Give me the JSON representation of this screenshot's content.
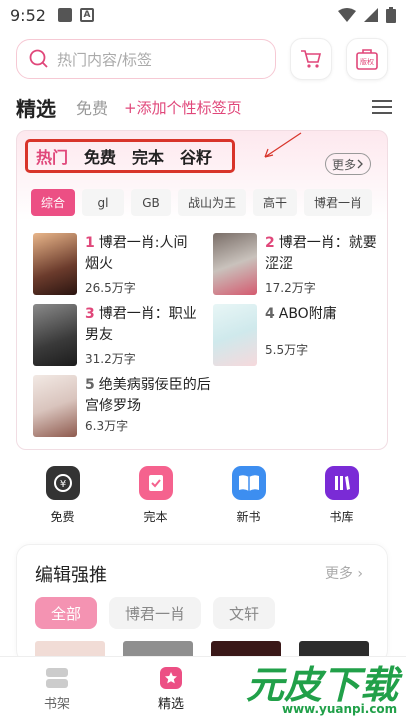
{
  "status": {
    "time": "9:52"
  },
  "search": {
    "placeholder": "热门内容/标签"
  },
  "header": {
    "badge_label": "版权"
  },
  "tabs": {
    "selected": "精选",
    "free": "免费",
    "add": "+添加个性标签页"
  },
  "hot": {
    "categories": [
      "热门",
      "免费",
      "完本",
      "谷籽"
    ],
    "more": "更多",
    "tags": [
      "综合",
      "gl",
      "GB",
      "战山为王",
      "高干",
      "博君一肖"
    ],
    "books": [
      {
        "rank": "1",
        "title": "博君一肖:人间烟火",
        "count": "26.5万字"
      },
      {
        "rank": "2",
        "title": "博君一肖：就要涩涩",
        "count": "17.2万字"
      },
      {
        "rank": "3",
        "title": "博君一肖：职业男友",
        "count": "31.2万字"
      },
      {
        "rank": "4",
        "title": "ABO附庸",
        "count": "5.5万字"
      },
      {
        "rank": "5",
        "title": "绝美病弱佞臣的后宫修罗场",
        "count": "6.3万字"
      }
    ]
  },
  "quick": [
    {
      "label": "免费",
      "icon": "coin-icon",
      "color": "#333333"
    },
    {
      "label": "完本",
      "icon": "check-book-icon",
      "color": "#f5628e"
    },
    {
      "label": "新书",
      "icon": "open-book-icon",
      "color": "#3d8ef0"
    },
    {
      "label": "书库",
      "icon": "library-icon",
      "color": "#7a2bd6"
    }
  ],
  "editor": {
    "title": "编辑强推",
    "more": "更多",
    "tabs": [
      "全部",
      "博君一肖",
      "文轩"
    ]
  },
  "nav": [
    {
      "label": "书架",
      "icon": "bookshelf-icon"
    },
    {
      "label": "精选",
      "icon": "star-icon"
    }
  ],
  "watermark": {
    "text": "元皮下载",
    "url": "www.yuanpi.com"
  },
  "colors": {
    "accent": "#e0477a",
    "highlight_box": "#d8342a",
    "watermark": "#21a049"
  }
}
